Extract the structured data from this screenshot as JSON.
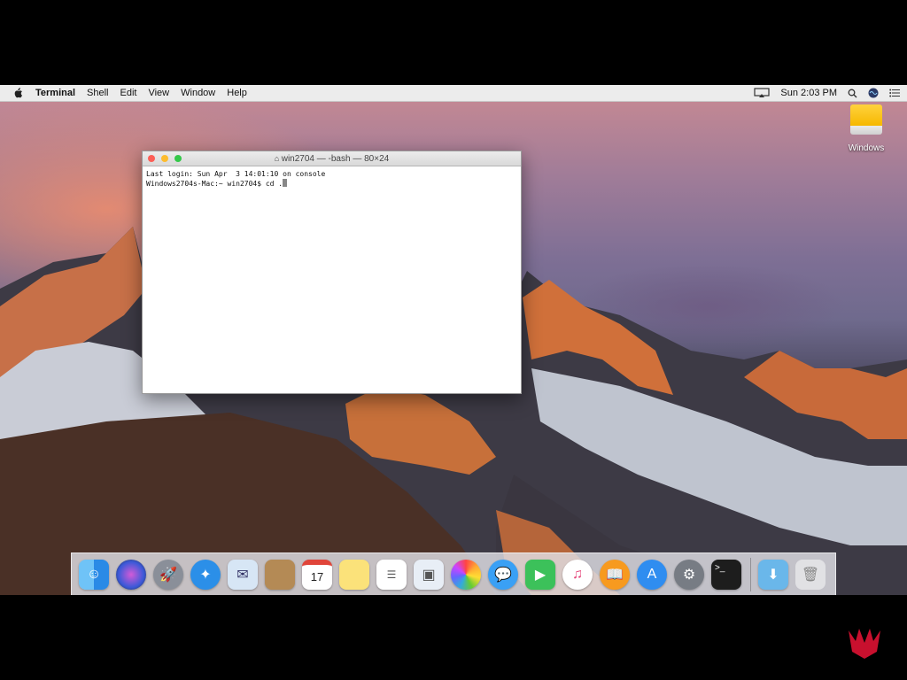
{
  "menubar": {
    "app_name": "Terminal",
    "menus": [
      "Shell",
      "Edit",
      "View",
      "Window",
      "Help"
    ],
    "clock": "Sun 2:03 PM"
  },
  "desktop": {
    "drive_label": "Windows"
  },
  "terminal": {
    "title": "win2704 — -bash — 80×24",
    "line1": "Last login: Sun Apr  3 14:01:10 on console",
    "prompt": "Windows2704s-Mac:~ win2704$ cd ."
  },
  "dock": {
    "calendar_day": "17",
    "items": [
      "finder-icon",
      "siri-icon",
      "launchpad-icon",
      "safari-icon",
      "mail-icon",
      "notes-icon",
      "calendar-icon",
      "stickies-icon",
      "reminders-icon",
      "preview-icon",
      "photos-icon",
      "messages-icon",
      "facetime-icon",
      "itunes-icon",
      "ibooks-icon",
      "app-store-icon",
      "system-preferences-icon",
      "terminal-icon",
      "downloads-folder-icon",
      "trash-icon"
    ]
  },
  "colors": {
    "menubar_bg": "#ececec",
    "close": "#fc5f57",
    "minimize": "#fdbc2e",
    "zoom": "#34c84a"
  }
}
